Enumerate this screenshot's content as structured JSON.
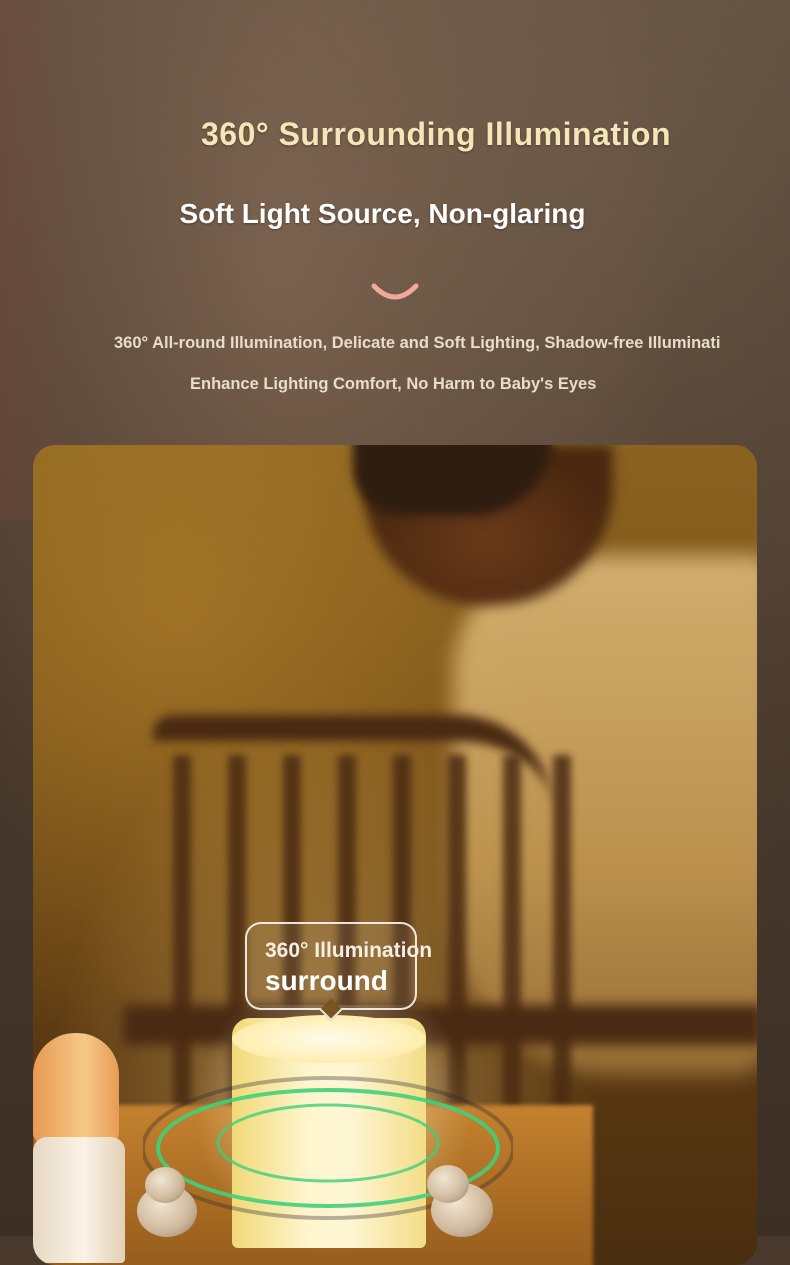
{
  "header": {
    "title": "360° Surrounding Illumination",
    "subtitle": "Soft Light Source, Non-glaring",
    "description_line_1": "360° All-round Illumination, Delicate and Soft Lighting, Shadow-free Illuminati",
    "description_line_2": "Enhance Lighting Comfort, No Harm to Baby's Eyes"
  },
  "photo": {
    "callout": {
      "line_1": "360° Illumination",
      "line_2": "surround"
    }
  },
  "colors": {
    "title": "#f5e6b8",
    "smile_accent": "#f2a89a",
    "ring_accent": "#3fd07a"
  },
  "icons": [
    "smile-icon",
    "light-ring-icon"
  ]
}
